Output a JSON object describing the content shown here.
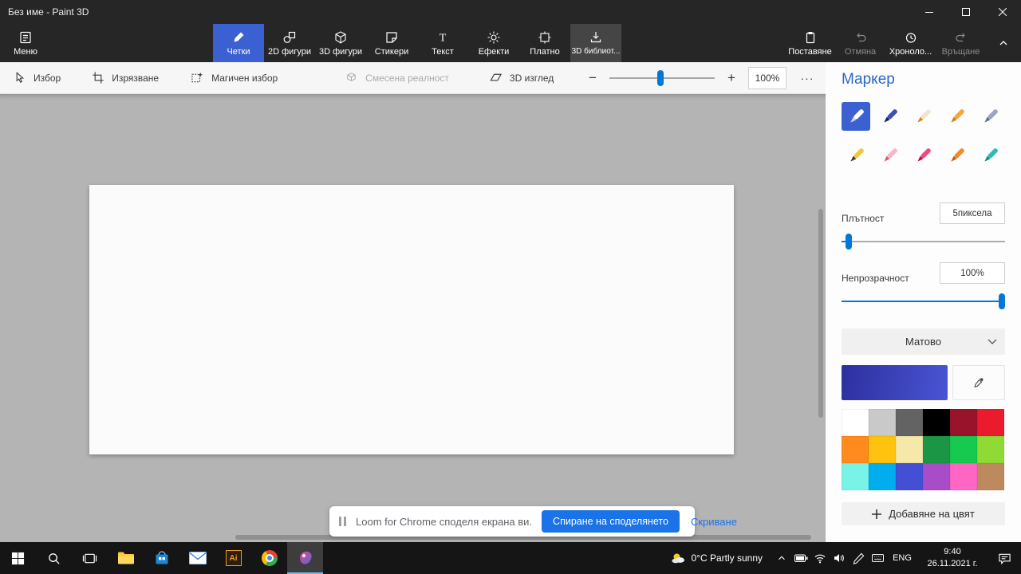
{
  "window": {
    "title": "Без име - Paint 3D"
  },
  "ribbon": {
    "menu_label": "Меню",
    "tabs": [
      {
        "label": "Четки",
        "icon": "brush-icon",
        "state": "selected"
      },
      {
        "label": "2D фигури",
        "icon": "shapes-2d-icon",
        "state": "normal"
      },
      {
        "label": "3D фигури",
        "icon": "shapes-3d-icon",
        "state": "normal"
      },
      {
        "label": "Стикери",
        "icon": "sticker-icon",
        "state": "normal"
      },
      {
        "label": "Текст",
        "icon": "text-icon",
        "state": "normal"
      },
      {
        "label": "Ефекти",
        "icon": "effects-icon",
        "state": "normal"
      },
      {
        "label": "Платно",
        "icon": "canvas-icon",
        "state": "normal"
      },
      {
        "label": "3D библиот...",
        "icon": "3d-library-icon",
        "state": "hover"
      }
    ],
    "actions": [
      {
        "label": "Поставяне",
        "icon": "paste-icon",
        "disabled": false
      },
      {
        "label": "Отмяна",
        "icon": "undo-icon",
        "disabled": true
      },
      {
        "label": "Хроноло...",
        "icon": "history-icon",
        "disabled": false
      },
      {
        "label": "Връщане",
        "icon": "redo-icon",
        "disabled": true
      }
    ]
  },
  "toolbar": {
    "tools": [
      {
        "label": "Избор",
        "icon": "select-cursor-icon",
        "disabled": false
      },
      {
        "label": "Изрязване",
        "icon": "crop-icon",
        "disabled": false
      },
      {
        "label": "Магичен избор",
        "icon": "magic-select-icon",
        "disabled": false
      },
      {
        "label": "Смесена реалност",
        "icon": "mixed-reality-icon",
        "disabled": true
      },
      {
        "label": "3D изглед",
        "icon": "3d-view-icon",
        "disabled": false
      }
    ],
    "zoom_out": "−",
    "zoom_in": "+",
    "zoom_level": "100%",
    "more": "···"
  },
  "panel": {
    "title": "Маркер",
    "brushes": [
      {
        "name": "marker",
        "selected": true,
        "body": "#ffffff",
        "tip": "#d8d8e8"
      },
      {
        "name": "calligraphy-pen",
        "selected": false,
        "body": "#3c4fb4",
        "tip": "#14205e"
      },
      {
        "name": "oil-brush",
        "selected": false,
        "body": "#efe6cf",
        "tip": "#e0821e"
      },
      {
        "name": "watercolor",
        "selected": false,
        "body": "#f2a93b",
        "tip": "#cc7a12"
      },
      {
        "name": "pixel-pen",
        "selected": false,
        "body": "#9aa7bc",
        "tip": "#5d6e86"
      },
      {
        "name": "pencil",
        "selected": false,
        "body": "#f5c63a",
        "tip": "#4a3a28"
      },
      {
        "name": "eraser",
        "selected": false,
        "body": "#f6b7c9",
        "tip": "#e05870"
      },
      {
        "name": "crayon",
        "selected": false,
        "body": "#ea4a7e",
        "tip": "#b8104e"
      },
      {
        "name": "spray-can",
        "selected": false,
        "body": "#f28a2e",
        "tip": "#c55d0e"
      },
      {
        "name": "fill",
        "selected": false,
        "body": "#2cbcb2",
        "tip": "#148a84"
      }
    ],
    "thickness_label": "Плътност",
    "thickness_value": "5пиксела",
    "opacity_label": "Непрозрачност",
    "opacity_value": "100%",
    "finish_value": "Матово",
    "current_color_gradient": [
      "#2c2f9e",
      "#4a55d4"
    ],
    "palette": [
      "#ffffff",
      "#c9c9c9",
      "#636363",
      "#000000",
      "#99132b",
      "#eb1b2d",
      "#ff8a1e",
      "#ffc20e",
      "#f6e8a8",
      "#1a9645",
      "#17c94f",
      "#8fdb34",
      "#79f2e7",
      "#00aef0",
      "#4350d6",
      "#a84cc8",
      "#ff66c4",
      "#bd8a5e"
    ],
    "add_color_label": "Добавяне на цвят"
  },
  "notification": {
    "message": "Loom for Chrome споделя екрана ви.",
    "stop_button": "Спиране на споделянето",
    "hide_label": "Скриване"
  },
  "taskbar": {
    "illustrator_label": "Ai",
    "weather": "0°C Partly sunny",
    "language": "ENG",
    "time": "9:40",
    "date": "26.11.2021 г."
  }
}
